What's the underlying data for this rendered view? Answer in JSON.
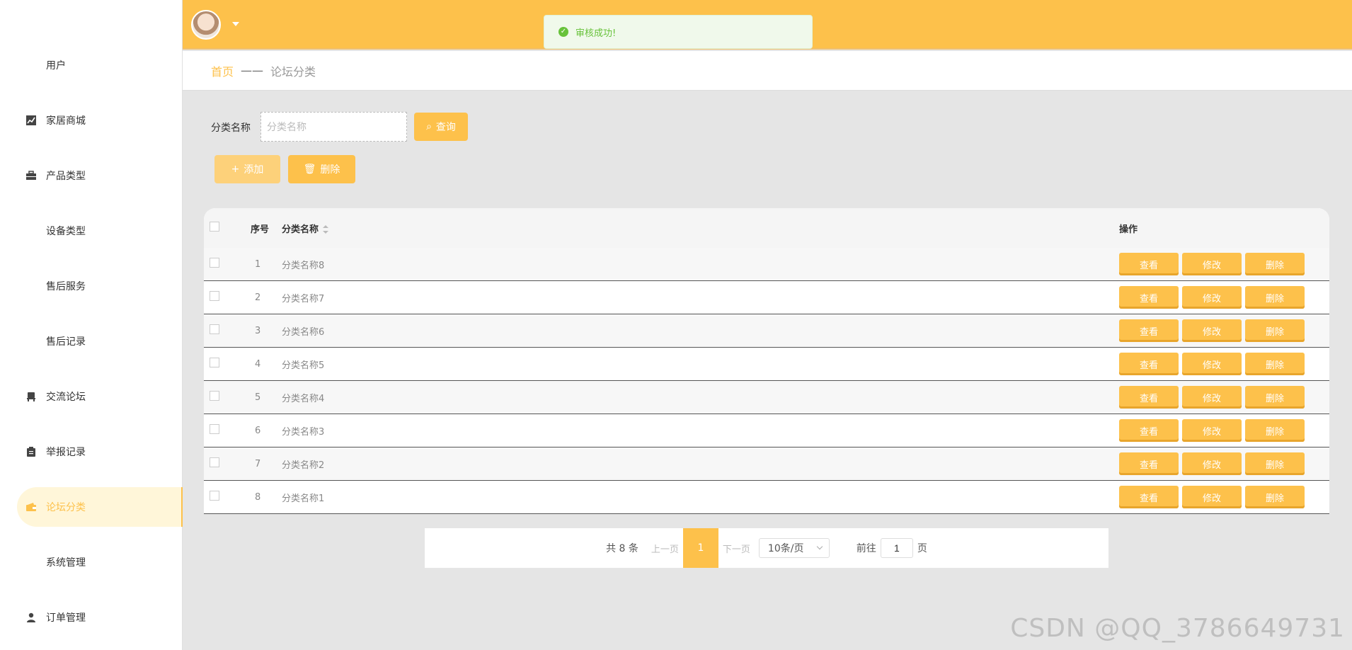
{
  "sidebar": {
    "items": [
      {
        "label": "用户",
        "icon": "grid-icon"
      },
      {
        "label": "家居商城",
        "icon": "chart-icon"
      },
      {
        "label": "产品类型",
        "icon": "briefcase-icon"
      },
      {
        "label": "设备类型",
        "icon": "grid-icon"
      },
      {
        "label": "售后服务",
        "icon": "grid-icon"
      },
      {
        "label": "售后记录",
        "icon": "grid-icon"
      },
      {
        "label": "交流论坛",
        "icon": "chair-icon"
      },
      {
        "label": "举报记录",
        "icon": "clipboard-icon"
      },
      {
        "label": "论坛分类",
        "icon": "wallet-icon",
        "active": true
      },
      {
        "label": "系统管理",
        "icon": "grid-icon"
      },
      {
        "label": "订单管理",
        "icon": "user-icon"
      }
    ]
  },
  "toast": {
    "message": "审核成功!"
  },
  "breadcrumb": {
    "home": "首页",
    "separator": "——",
    "current": "论坛分类"
  },
  "search": {
    "label": "分类名称",
    "placeholder": "分类名称",
    "query_button": "查询"
  },
  "actions": {
    "add_button": "添加",
    "delete_button": "删除"
  },
  "table": {
    "headers": {
      "index": "序号",
      "name": "分类名称",
      "ops": "操作"
    },
    "rows": [
      {
        "index": "1",
        "name": "分类名称8"
      },
      {
        "index": "2",
        "name": "分类名称7"
      },
      {
        "index": "3",
        "name": "分类名称6"
      },
      {
        "index": "4",
        "name": "分类名称5"
      },
      {
        "index": "5",
        "name": "分类名称4"
      },
      {
        "index": "6",
        "name": "分类名称3"
      },
      {
        "index": "7",
        "name": "分类名称2"
      },
      {
        "index": "8",
        "name": "分类名称1"
      }
    ],
    "op_labels": {
      "view": "查看",
      "edit": "修改",
      "delete": "删除"
    }
  },
  "pagination": {
    "total": "共 8 条",
    "prev": "上一页",
    "current_page": "1",
    "next": "下一页",
    "page_size": "10条/页",
    "goto_prefix": "前往",
    "goto_value": "1",
    "goto_suffix": "页"
  },
  "watermark": "CSDN @QQ_3786649731",
  "colors": {
    "accent": "#fdc14b",
    "success": "#67c23a"
  }
}
